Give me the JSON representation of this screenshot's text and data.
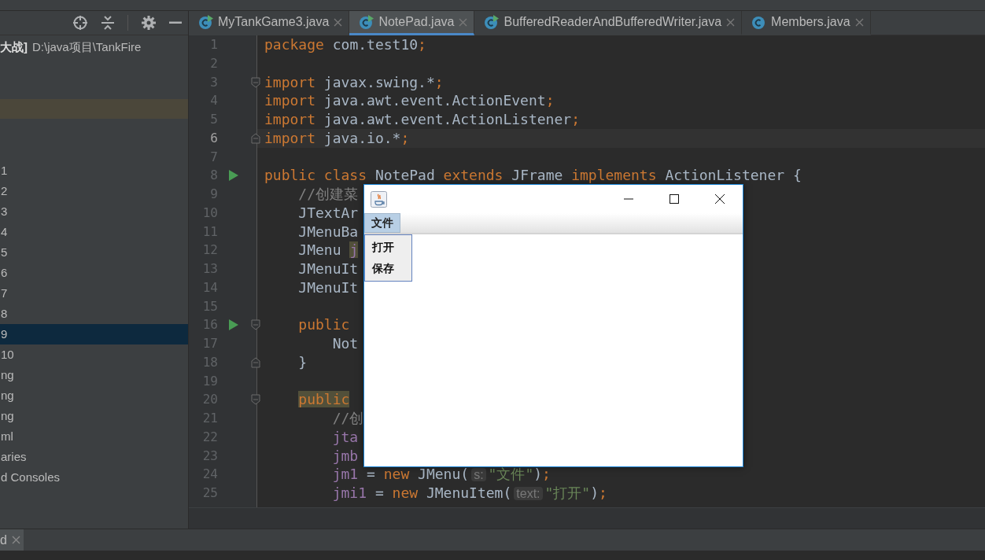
{
  "project_panel": {
    "root": {
      "name": "大战]",
      "path": "D:\\java项目\\TankFire"
    },
    "tree": [
      {
        "label": "1",
        "selected": false
      },
      {
        "label": "2",
        "selected": false
      },
      {
        "label": "3",
        "selected": false
      },
      {
        "label": "4",
        "selected": false
      },
      {
        "label": "5",
        "selected": false
      },
      {
        "label": "6",
        "selected": false
      },
      {
        "label": "7",
        "selected": false
      },
      {
        "label": "8",
        "selected": false
      },
      {
        "label": "9",
        "selected": true
      },
      {
        "label": "10",
        "selected": false
      },
      {
        "label": "ng",
        "selected": false
      },
      {
        "label": "ng",
        "selected": false
      },
      {
        "label": "ng",
        "selected": false
      },
      {
        "label": "ml",
        "selected": false
      },
      {
        "label": "aries",
        "selected": false
      },
      {
        "label": "d Consoles",
        "selected": false
      }
    ]
  },
  "editor": {
    "tabs": [
      {
        "label": "MyTankGame3.java",
        "runnable": true,
        "selected": false
      },
      {
        "label": "NotePad.java",
        "runnable": true,
        "selected": true
      },
      {
        "label": "BufferedReaderAndBufferedWriter.java",
        "runnable": true,
        "selected": false
      },
      {
        "label": "Members.java",
        "runnable": false,
        "selected": false
      }
    ],
    "lines": [
      {
        "number": "1",
        "current": false,
        "tokens": [
          {
            "t": "package ",
            "kind": "keyword"
          },
          {
            "t": "com.test10",
            "kind": "plain"
          },
          {
            "t": ";",
            "kind": "keyword"
          }
        ]
      },
      {
        "number": "2",
        "current": false
      },
      {
        "number": "3",
        "current": false,
        "gutter": [
          {
            "kind": "fold_start"
          }
        ],
        "tokens": [
          {
            "t": "import ",
            "kind": "keyword"
          },
          {
            "t": "javax.swing.*",
            "kind": "plain"
          },
          {
            "t": ";",
            "kind": "keyword"
          }
        ]
      },
      {
        "number": "4",
        "current": false,
        "tokens": [
          {
            "t": "import ",
            "kind": "keyword"
          },
          {
            "t": "java.awt.event.ActionEvent",
            "kind": "plain"
          },
          {
            "t": ";",
            "kind": "keyword"
          }
        ]
      },
      {
        "number": "5",
        "current": false,
        "tokens": [
          {
            "t": "import ",
            "kind": "keyword"
          },
          {
            "t": "java.awt.event.ActionListener",
            "kind": "plain"
          },
          {
            "t": ";",
            "kind": "keyword"
          }
        ]
      },
      {
        "number": "6",
        "current": true,
        "gutter": [
          {
            "kind": "fold_end"
          }
        ],
        "tokens": [
          {
            "t": "import ",
            "kind": "keyword"
          },
          {
            "t": "java.io.*",
            "kind": "plain"
          },
          {
            "t": ";",
            "kind": "keyword"
          }
        ]
      },
      {
        "number": "7",
        "current": false
      },
      {
        "number": "8",
        "current": false,
        "gutter": [
          {
            "kind": "run"
          }
        ],
        "tokens": [
          {
            "t": "public class ",
            "kind": "keyword"
          },
          {
            "t": "NotePad ",
            "kind": "plain"
          },
          {
            "t": "extends ",
            "kind": "keyword"
          },
          {
            "t": "JFrame ",
            "kind": "plain"
          },
          {
            "t": "implements ",
            "kind": "keyword"
          },
          {
            "t": "ActionListener {",
            "kind": "plain"
          }
        ]
      },
      {
        "number": "9",
        "current": false,
        "tokens": [
          {
            "t": "    //创建菜",
            "kind": "comment"
          }
        ]
      },
      {
        "number": "10",
        "current": false,
        "tokens": [
          {
            "t": "    JTextAr",
            "kind": "plain"
          }
        ]
      },
      {
        "number": "11",
        "current": false,
        "tokens": [
          {
            "t": "    JMenuBa",
            "kind": "plain"
          }
        ]
      },
      {
        "number": "12",
        "current": false,
        "tokens": [
          {
            "t": "    JMenu ",
            "kind": "plain"
          },
          {
            "t": "j",
            "kind": "field",
            "marked": true
          }
        ]
      },
      {
        "number": "13",
        "current": false,
        "tokens": [
          {
            "t": "    JMenuIt",
            "kind": "plain"
          }
        ]
      },
      {
        "number": "14",
        "current": false,
        "tokens": [
          {
            "t": "    JMenuIt",
            "kind": "plain"
          }
        ]
      },
      {
        "number": "15",
        "current": false
      },
      {
        "number": "16",
        "current": false,
        "gutter": [
          {
            "kind": "run"
          },
          {
            "kind": "fold_start"
          }
        ],
        "tokens": [
          {
            "t": "    public",
            "kind": "keyword"
          }
        ]
      },
      {
        "number": "17",
        "current": false,
        "tokens": [
          {
            "t": "        Not",
            "kind": "plain"
          }
        ]
      },
      {
        "number": "18",
        "current": false,
        "gutter": [
          {
            "kind": "fold_end"
          }
        ],
        "tokens": [
          {
            "t": "    }",
            "kind": "plain"
          }
        ]
      },
      {
        "number": "19",
        "current": false
      },
      {
        "number": "20",
        "current": false,
        "gutter": [
          {
            "kind": "fold_start"
          }
        ],
        "tokens": [
          {
            "t": "    public",
            "kind": "keyword",
            "marked": true
          }
        ]
      },
      {
        "number": "21",
        "current": false,
        "tokens": [
          {
            "t": "        //创",
            "kind": "comment"
          }
        ]
      },
      {
        "number": "22",
        "current": false,
        "tokens": [
          {
            "t": "        jta",
            "kind": "field"
          }
        ]
      },
      {
        "number": "23",
        "current": false,
        "tokens": [
          {
            "t": "        jmb",
            "kind": "field"
          }
        ]
      },
      {
        "number": "24",
        "current": false,
        "tokens": [
          {
            "t": "        jm1",
            "kind": "field"
          },
          {
            "t": " = ",
            "kind": "plain"
          },
          {
            "t": "new ",
            "kind": "keyword"
          },
          {
            "t": "JMenu(",
            "kind": "plain"
          },
          {
            "t": "s:",
            "kind": "hint"
          },
          {
            "t": "\"文件\"",
            "kind": "string"
          },
          {
            "t": ")",
            "kind": "plain"
          },
          {
            "t": ";",
            "kind": "keyword"
          }
        ]
      },
      {
        "number": "25",
        "current": false,
        "tokens": [
          {
            "t": "        jmi1",
            "kind": "field"
          },
          {
            "t": " = ",
            "kind": "plain"
          },
          {
            "t": "new ",
            "kind": "keyword"
          },
          {
            "t": "JMenuItem(",
            "kind": "plain"
          },
          {
            "t": "text:",
            "kind": "hint"
          },
          {
            "t": "\"打开\"",
            "kind": "string"
          },
          {
            "t": ")",
            "kind": "plain"
          },
          {
            "t": ";",
            "kind": "keyword"
          }
        ]
      }
    ]
  },
  "app_window": {
    "menus": [
      {
        "label": "文件",
        "selected": true
      }
    ],
    "menu_items": [
      {
        "label": "打开"
      },
      {
        "label": "保存"
      }
    ]
  },
  "bottom_panel": {
    "tabs": [
      {
        "label": "d",
        "selected": true
      }
    ]
  }
}
